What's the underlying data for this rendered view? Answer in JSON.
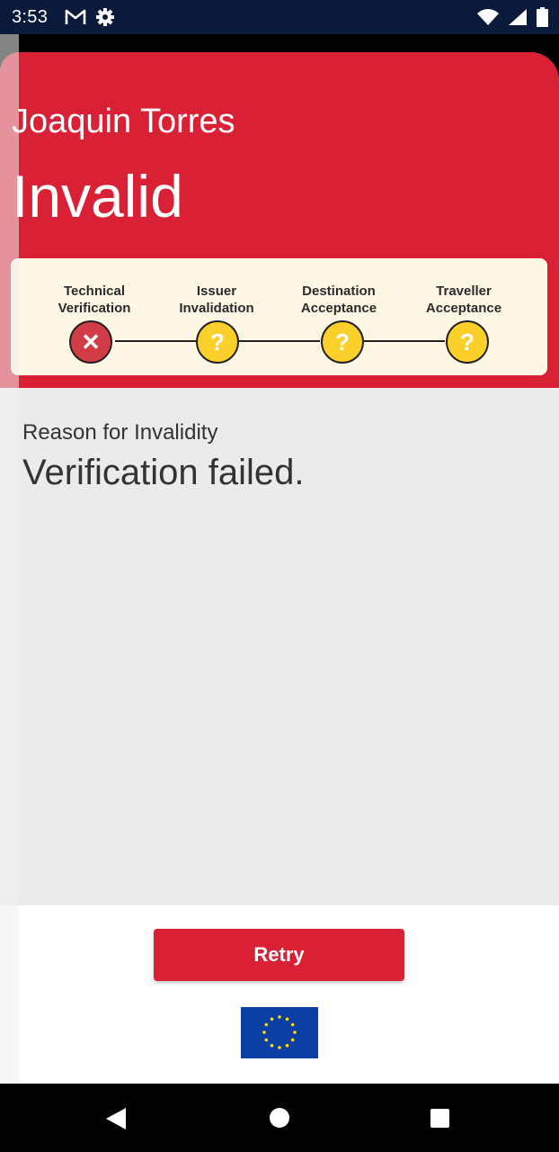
{
  "status_bar": {
    "time": "3:53",
    "icons": [
      "gmail-icon",
      "settings-icon",
      "wifi-icon",
      "signal-icon",
      "battery-icon"
    ]
  },
  "header": {
    "name": "Joaquin Torres",
    "status": "Invalid",
    "color": "#d92035"
  },
  "steps": [
    {
      "label_line1": "Technical",
      "label_line2": "Verification",
      "state": "failed",
      "symbol": "✕"
    },
    {
      "label_line1": "Issuer",
      "label_line2": "Invalidation",
      "state": "unknown",
      "symbol": "?"
    },
    {
      "label_line1": "Destination",
      "label_line2": "Acceptance",
      "state": "unknown",
      "symbol": "?"
    },
    {
      "label_line1": "Traveller",
      "label_line2": "Acceptance",
      "state": "unknown",
      "symbol": "?"
    }
  ],
  "reason": {
    "label": "Reason for Invalidity",
    "text": "Verification failed."
  },
  "footer": {
    "retry_label": "Retry",
    "flag": "eu-flag"
  },
  "nav": {
    "icons": [
      "back-icon",
      "home-icon",
      "recents-icon"
    ]
  }
}
